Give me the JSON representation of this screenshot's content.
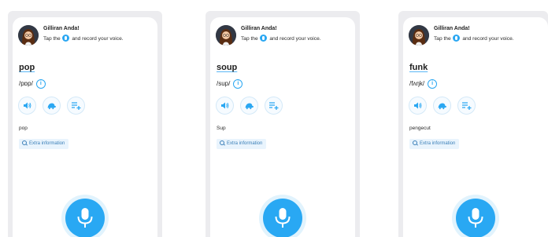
{
  "screens": [
    {
      "greeting": "Gilliran Anda!",
      "instruction_before": "Tap the",
      "instruction_after": "and record your voice.",
      "word": "pop",
      "phonetic": "/pɒp/",
      "definition": "pop",
      "extra_label": "Extra information"
    },
    {
      "greeting": "Gilliran Anda!",
      "instruction_before": "Tap the",
      "instruction_after": "and record your voice.",
      "word": "soup",
      "phonetic": "/sup/",
      "definition": "Sup",
      "extra_label": "Extra information"
    },
    {
      "greeting": "Gilliran Anda!",
      "instruction_before": "Tap the",
      "instruction_after": "and record your voice.",
      "word": "funk",
      "phonetic": "/fʌŋk/",
      "definition": "pengecut",
      "extra_label": "Extra information"
    }
  ],
  "icons": {
    "info": "info-icon",
    "speaker": "speaker-icon",
    "slow_speaker": "turtle-icon",
    "add_to_list": "playlist-add-icon",
    "search": "search-icon",
    "mic": "microphone-icon"
  },
  "colors": {
    "accent": "#29a8f3",
    "chip_background": "#e9f4fd",
    "frame": "#ececef"
  }
}
